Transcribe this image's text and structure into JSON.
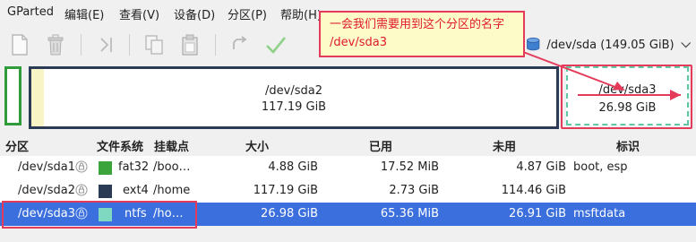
{
  "menubar": {
    "items": [
      "GParted",
      "编辑(E)",
      "查看(V)",
      "设备(D)",
      "分区(P)",
      "帮助(H)"
    ]
  },
  "toolbar": {
    "buttons": [
      "new-icon",
      "delete-icon",
      "resize-move-icon",
      "copy-icon",
      "paste-icon",
      "undo-icon",
      "apply-icon"
    ],
    "device_label": "/dev/sda (149.05 GiB)"
  },
  "callout": {
    "line1": "一会我们需要用到这个分区的名字",
    "line2": "/dev/sda3"
  },
  "graphic": {
    "sda2_name": "/dev/sda2",
    "sda2_size": "117.19 GiB",
    "sda3_name": "/dev/sda3",
    "sda3_size": "26.98 GiB"
  },
  "table": {
    "headers": {
      "partition": "分区",
      "filesystem": "文件系统",
      "mountpoint": "挂载点",
      "size": "大小",
      "used": "已用",
      "unused": "未用",
      "flags": "标识"
    },
    "rows": [
      {
        "partition": "/dev/sda1",
        "fs": "fat32",
        "fs_color": "#3ba53b",
        "mount": "/boo…",
        "size": "4.88 GiB",
        "used": "17.52 MiB",
        "unused": "4.87 GiB",
        "flags": "boot, esp"
      },
      {
        "partition": "/dev/sda2",
        "fs": "ext4",
        "fs_color": "#2b3b55",
        "mount": "/home",
        "size": "117.19 GiB",
        "used": "2.73 GiB",
        "unused": "114.46 GiB",
        "flags": ""
      },
      {
        "partition": "/dev/sda3",
        "fs": "ntfs",
        "fs_color": "#7fd9c0",
        "mount": "/ho…",
        "size": "26.98 GiB",
        "used": "65.36 MiB",
        "unused": "26.91 GiB",
        "flags": "msftdata"
      }
    ]
  },
  "colors": {
    "annotation": "#e53b5a",
    "selection": "#3b6fde",
    "sda2_border": "#2b3b55",
    "sda1_border": "#2f9b3a"
  }
}
